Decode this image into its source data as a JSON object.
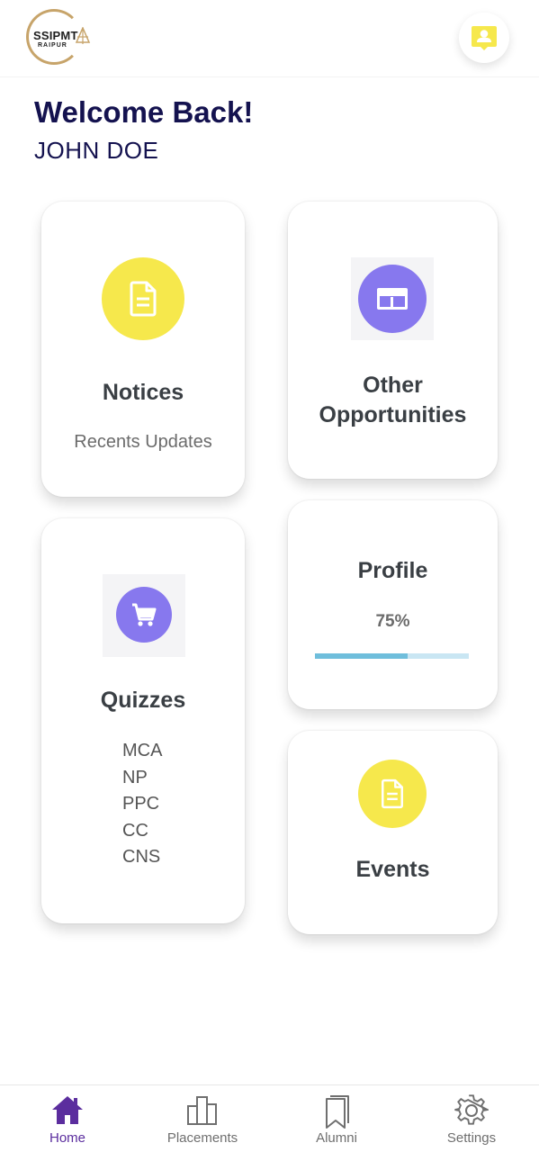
{
  "header": {
    "logo_name": "SSIPMT",
    "logo_city": "RAIPUR",
    "contact_icon": "contact-card-icon"
  },
  "greeting": {
    "title": "Welcome Back!",
    "user_name": "JOHN DOE"
  },
  "cards": {
    "notices": {
      "title": "Notices",
      "subtitle": "Recents Updates",
      "icon": "document-icon",
      "icon_color": "#f6e84c"
    },
    "opportunities": {
      "title_line1": "Other",
      "title_line2": "Opportunities",
      "icon": "layout-grid-icon",
      "icon_color": "#8778ee"
    },
    "quizzes": {
      "title": "Quizzes",
      "icon": "shopping-cart-icon",
      "icon_color": "#8778ee",
      "items": [
        "MCA",
        "NP",
        "PPC",
        "CC",
        "CNS"
      ]
    },
    "profile": {
      "title": "Profile",
      "completion_label": "75%",
      "completion_fraction": 0.6
    },
    "events": {
      "title": "Events",
      "icon": "document-icon",
      "icon_color": "#f6e84c"
    }
  },
  "nav": {
    "active": "home",
    "items": [
      {
        "key": "home",
        "label": "Home",
        "icon": "home-icon"
      },
      {
        "key": "placements",
        "label": "Placements",
        "icon": "bar-chart-icon"
      },
      {
        "key": "alumni",
        "label": "Alumni",
        "icon": "bookmark-icon"
      },
      {
        "key": "settings",
        "label": "Settings",
        "icon": "gear-icon"
      }
    ]
  },
  "colors": {
    "primary_text": "#14124f",
    "accent_yellow": "#f6e84c",
    "accent_purple": "#8778ee",
    "nav_active": "#5b2d9e",
    "progress_fill": "#6fbedc"
  }
}
